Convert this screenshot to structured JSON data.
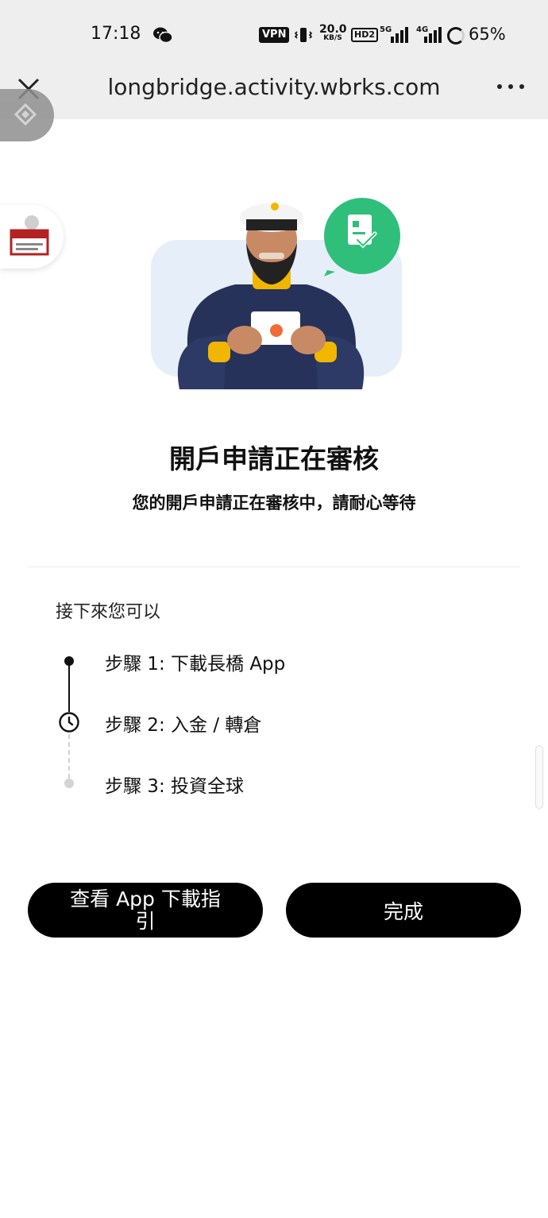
{
  "status_bar": {
    "time": "17:18",
    "vpn": "VPN",
    "net_speed_value": "20.0",
    "net_speed_unit": "KB/S",
    "hd": "HD2",
    "sig1": "5G",
    "sig2": "4G",
    "battery": "65%"
  },
  "browser": {
    "url": "longbridge.activity.wbrks.com"
  },
  "main": {
    "title": "開戶申請正在審核",
    "subtitle": "您的開戶申請正在審核中，請耐心等待",
    "next_label": "接下來您可以",
    "steps": [
      {
        "label": "步驟 1:  下載長橋 App",
        "status": "done"
      },
      {
        "label": "步驟 2:  入金 / 轉倉",
        "status": "in-progress"
      },
      {
        "label": "步驟 3:  投資全球",
        "status": "pending"
      }
    ]
  },
  "actions": {
    "guide_label": "查看 App 下載指引",
    "done_label": "完成"
  },
  "colors": {
    "accent_green": "#2fbf7a",
    "button_bg": "#000000",
    "chrome_bg": "#eeeeee"
  }
}
